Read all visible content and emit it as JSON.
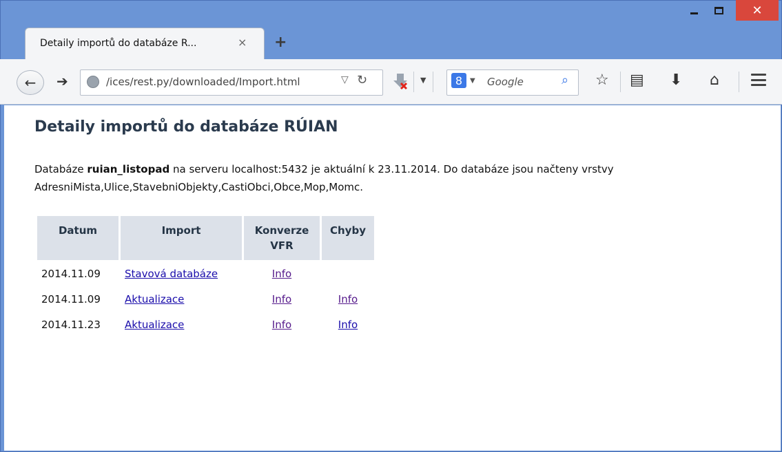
{
  "browser": {
    "tab_title": "Detaily importů do databáze R...",
    "tab_close": "×",
    "new_tab": "+",
    "url": "/ices/rest.py/downloaded/Import.html",
    "search_engine_letter": "8",
    "search_placeholder": "Google",
    "window_close": "✕"
  },
  "page": {
    "title": "Detaily importů do databáze RÚIAN",
    "info_prefix": "Databáze ",
    "db_name": "ruian_listopad",
    "info_middle": " na serveru localhost:5432 je aktuální k 23.11.2014. Do databáze jsou načteny vrstvy AdresniMista,Ulice,StavebniObjekty,CastiObci,Obce,Mop,Momc."
  },
  "table": {
    "headers": {
      "datum": "Datum",
      "import": "Import",
      "konverze": "Konverze VFR",
      "chyby": "Chyby"
    },
    "rows": [
      {
        "datum": "2014.11.09",
        "import": "Stavová databáze",
        "konverze": "Info",
        "chyby": ""
      },
      {
        "datum": "2014.11.09",
        "import": "Aktualizace",
        "konverze": "Info",
        "chyby": "Info"
      },
      {
        "datum": "2014.11.23",
        "import": "Aktualizace",
        "konverze": "Info",
        "chyby": "Info"
      }
    ]
  },
  "colors": {
    "window_frame": "#6b95d6",
    "close_button": "#d9473c",
    "link": "#1a0dab",
    "visited_link": "#551a8b",
    "table_header_bg": "#dce1e9",
    "title": "#2b3b4e"
  }
}
